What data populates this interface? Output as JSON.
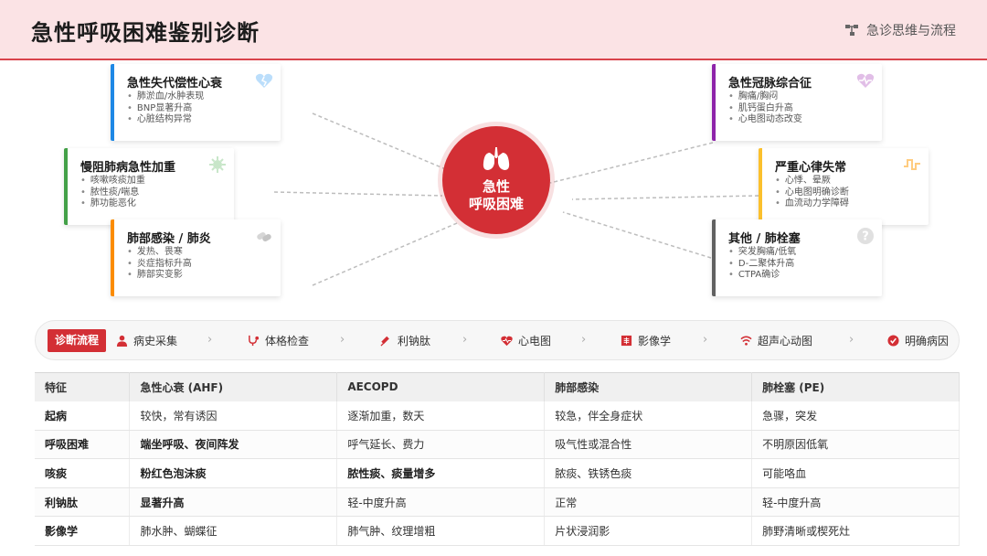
{
  "header": {
    "title": "急性呼吸困难鉴别诊断",
    "tag": "急诊思维与流程",
    "tag_icon": "network-icon"
  },
  "center": {
    "line1": "急性",
    "line2": "呼吸困难",
    "icon": "lungs-icon",
    "color": "#d32f35"
  },
  "cards": [
    {
      "title": "急性失代偿性心衰",
      "items": [
        "肺淤血/水肿表现",
        "BNP显著升高",
        "心脏结构异常"
      ],
      "color": "#1e88e5",
      "icon": "heart-broken-icon"
    },
    {
      "title": "慢阻肺病急性加重",
      "items": [
        "咳嗽咳痰加重",
        "脓性痰/喘息",
        "肺功能恶化"
      ],
      "color": "#43a047",
      "icon": "virus-icon"
    },
    {
      "title": "肺部感染 / 肺炎",
      "items": [
        "发热、畏寒",
        "炎症指标升高",
        "肺部实变影"
      ],
      "color": "#fb8c00",
      "icon": "bacteria-icon"
    },
    {
      "title": "急性冠脉综合征",
      "items": [
        "胸痛/胸闷",
        "肌钙蛋白升高",
        "心电图动态改变"
      ],
      "color": "#8e24aa",
      "icon": "heart-pulse-icon"
    },
    {
      "title": "严重心律失常",
      "items": [
        "心悸、晕厥",
        "心电图明确诊断",
        "血流动力学障碍"
      ],
      "color": "#fbc02d",
      "icon": "wave-square-icon"
    },
    {
      "title": "其他 / 肺栓塞",
      "items": [
        "突发胸痛/低氧",
        "D-二聚体升高",
        "CTPA确诊"
      ],
      "color": "#616161",
      "icon": "question-icon"
    }
  ],
  "flow": {
    "label": "诊断流程",
    "steps": [
      {
        "label": "病史采集",
        "icon": "user-injured-icon"
      },
      {
        "label": "体格检查",
        "icon": "stethoscope-icon"
      },
      {
        "label": "利钠肽",
        "icon": "syringe-icon"
      },
      {
        "label": "心电图",
        "icon": "heartbeat-icon"
      },
      {
        "label": "影像学",
        "icon": "xray-icon"
      },
      {
        "label": "超声心动图",
        "icon": "wifi-icon"
      },
      {
        "label": "明确病因",
        "icon": "check-circle-icon"
      }
    ]
  },
  "table": {
    "headers": [
      "特征",
      "急性心衰 (AHF)",
      "AECOPD",
      "肺部感染",
      "肺栓塞 (PE)"
    ],
    "rows": [
      [
        "起病",
        "较快，常有诱因",
        "逐渐加重，数天",
        "较急，伴全身症状",
        "急骤，突发"
      ],
      [
        "呼吸困难",
        "端坐呼吸、夜间阵发",
        "呼气延长、费力",
        "吸气性或混合性",
        "不明原因低氧"
      ],
      [
        "咳痰",
        "粉红色泡沫痰",
        "脓性痰、痰量增多",
        "脓痰、铁锈色痰",
        "可能咯血"
      ],
      [
        "利钠肽",
        "显著升高",
        "轻-中度升高",
        "正常",
        "轻-中度升高"
      ],
      [
        "影像学",
        "肺水肿、蝴蝶征",
        "肺气肿、纹理增粗",
        "片状浸润影",
        "肺野清晰或楔死灶"
      ]
    ]
  }
}
